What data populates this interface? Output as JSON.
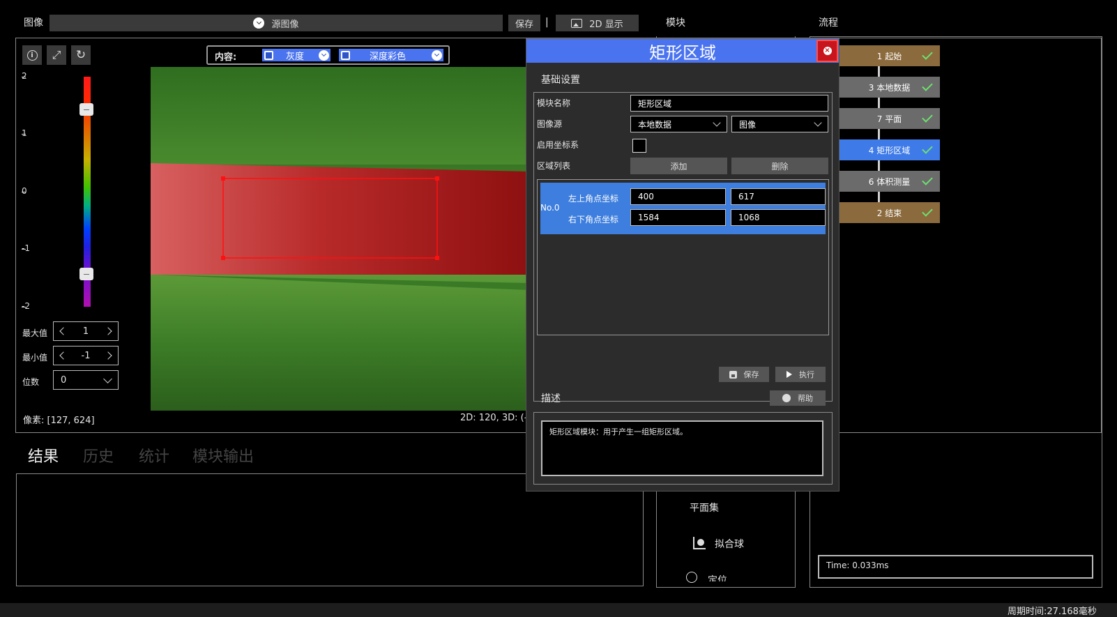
{
  "colors": {
    "accent": "#4a73f0",
    "selected_row": "#3d7ede",
    "flow_brown": "#8b6a3d",
    "flow_gray": "#6b6b6b",
    "flow_blue": "#3e7be8",
    "close_red": "#c8141c"
  },
  "toolbar": {
    "image_label": "图像",
    "source_label": "源图像",
    "save_label": "保存",
    "separator": "|",
    "display_label": "2D 显示",
    "module_header": "模块",
    "flow_header": "流程"
  },
  "viewer": {
    "content_label": "内容:",
    "gray_label": "灰度",
    "depth_label": "深度彩色",
    "scale_ticks": [
      "2",
      "1",
      "0",
      "-1",
      "-2"
    ],
    "max_label": "最大值",
    "max_value": "1",
    "min_label": "最小值",
    "min_value": "-1",
    "digits_label": "位数",
    "digits_value": "0",
    "pixel_readout": "像素: [127, 624]",
    "coord_readout": "2D: 120, 3D: (-"
  },
  "result_tabs": [
    "结果",
    "历史",
    "统计",
    "模块输出"
  ],
  "module_list": {
    "items": [
      "平面集",
      "拟合球",
      "定位"
    ]
  },
  "flow": {
    "nodes": [
      {
        "label": "1 起始",
        "state": "brown"
      },
      {
        "label": "3 本地数据",
        "state": "gray"
      },
      {
        "label": "7 平面",
        "state": "gray"
      },
      {
        "label": "4 矩形区域",
        "state": "blue"
      },
      {
        "label": "6 体积测量",
        "state": "gray"
      },
      {
        "label": "2 结束",
        "state": "brown"
      }
    ],
    "time": "Time: 0.033ms"
  },
  "dialog": {
    "title": "矩形区域",
    "section_basic": "基础设置",
    "module_name_label": "模块名称",
    "module_name_value": "矩形区域",
    "image_source_label": "图像源",
    "image_source_value": "本地数据",
    "image_source_value2": "图像",
    "coord_sys_label": "启用坐标系",
    "region_list_label": "区域列表",
    "add_label": "添加",
    "delete_label": "删除",
    "row": {
      "index": "No.0",
      "top_left_label": "左上角点坐标",
      "top_left_x": "400",
      "top_left_y": "617",
      "bottom_right_label": "右下角点坐标",
      "bottom_right_x": "1584",
      "bottom_right_y": "1068"
    },
    "save_label": "保存",
    "run_label": "执行",
    "desc_label": "描述",
    "help_label": "帮助",
    "desc_text": "矩形区域模块：用于产生一组矩形区域。"
  },
  "status": {
    "cycle_time": "周期时间:27.168毫秒"
  }
}
